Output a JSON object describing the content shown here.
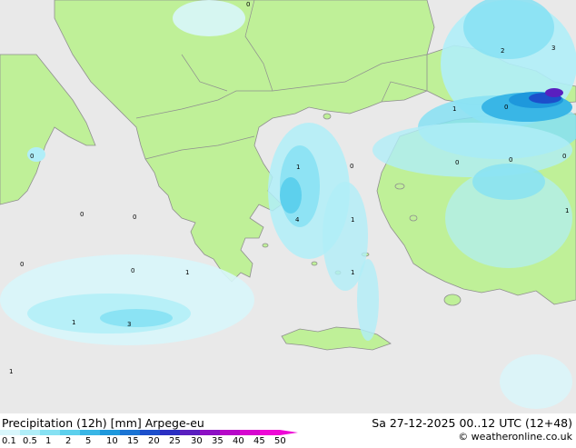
{
  "footer": {
    "title": "Precipitation (12h) [mm] Arpege-eu",
    "valid_time": "Sa 27-12-2025 00..12 UTC (12+48)",
    "credit": "© weatheronline.co.uk"
  },
  "legend": {
    "levels": [
      "0.1",
      "0.5",
      "1",
      "2",
      "5",
      "10",
      "15",
      "20",
      "25",
      "30",
      "35",
      "40",
      "45",
      "50"
    ],
    "colors": [
      "#d8f6fb",
      "#b0eef8",
      "#86e1f3",
      "#5dd0ed",
      "#39b6e6",
      "#1e98dc",
      "#1a74d4",
      "#1c4fcb",
      "#2b2fc2",
      "#5a1fbf",
      "#8c10c4",
      "#b608c8",
      "#d606cf",
      "#ee08d6"
    ]
  },
  "colors": {
    "land": "#bff098",
    "sea": "#e9e9e9",
    "border": "#8f8f8f"
  },
  "map_labels": [
    {
      "id": "v-top",
      "text": "0"
    },
    {
      "id": "v-2",
      "text": "2"
    },
    {
      "id": "v-3",
      "text": "3"
    },
    {
      "id": "v-turkey-1",
      "text": "1"
    },
    {
      "id": "v-turkey-0-a",
      "text": "0"
    },
    {
      "id": "v-aegean-1",
      "text": "1"
    },
    {
      "id": "v-aegean-0",
      "text": "0"
    },
    {
      "id": "v-anatolia-0-a",
      "text": "0"
    },
    {
      "id": "v-anatolia-0-b",
      "text": "0"
    },
    {
      "id": "v-anatolia-0-c",
      "text": "0"
    },
    {
      "id": "v-italy-0",
      "text": "0"
    },
    {
      "id": "v-ionian-0-a",
      "text": "0"
    },
    {
      "id": "v-ionian-0-b",
      "text": "0"
    },
    {
      "id": "v-greece-4",
      "text": "4"
    },
    {
      "id": "v-aegean-1-b",
      "text": "1"
    },
    {
      "id": "v-east-1",
      "text": "1"
    },
    {
      "id": "v-sicily-0",
      "text": "0"
    },
    {
      "id": "v-sea-0",
      "text": "0"
    },
    {
      "id": "v-sea-1",
      "text": "1"
    },
    {
      "id": "v-crete-1",
      "text": "1"
    },
    {
      "id": "v-south-1",
      "text": "1"
    },
    {
      "id": "v-south-3",
      "text": "3"
    },
    {
      "id": "v-sw-1",
      "text": "1"
    }
  ]
}
